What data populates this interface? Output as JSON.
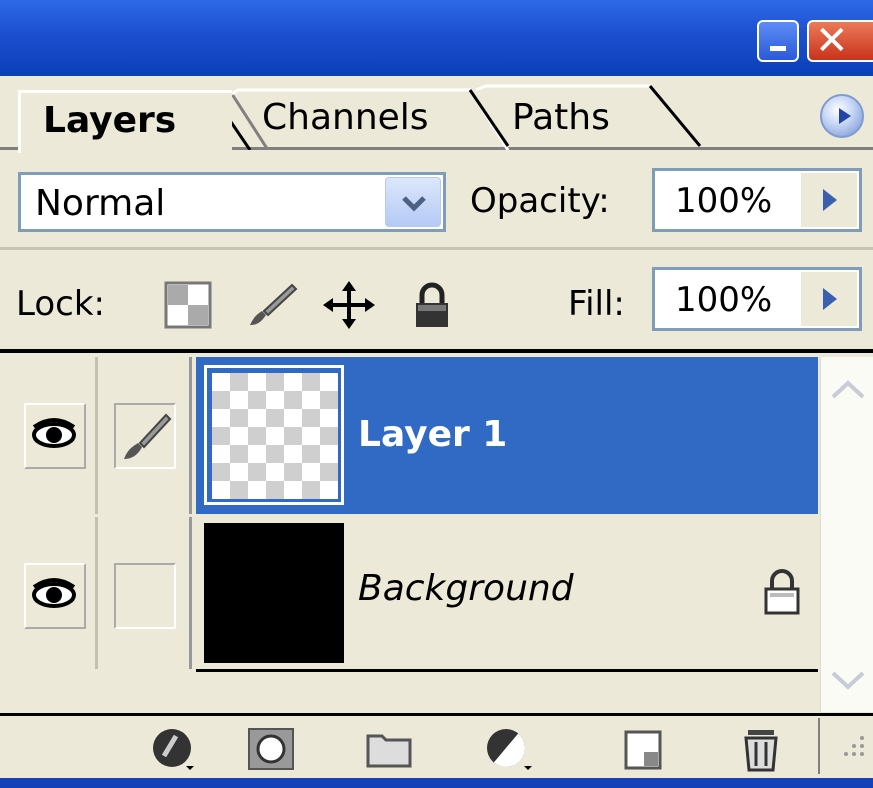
{
  "window": {
    "minimize_icon": "minimize-icon",
    "close_icon": "close-icon",
    "close_glyph": "✕"
  },
  "tabs": [
    {
      "label": "Layers",
      "active": true
    },
    {
      "label": "Channels",
      "active": false
    },
    {
      "label": "Paths",
      "active": false
    }
  ],
  "panel_menu_icon": "arrow-right-icon",
  "blend": {
    "mode": "Normal",
    "opacity_label": "Opacity:",
    "opacity_value": "100%"
  },
  "lock": {
    "label": "Lock:",
    "icons": [
      "transparency-lock-icon",
      "brush-lock-icon",
      "move-lock-icon",
      "padlock-icon"
    ],
    "fill_label": "Fill:",
    "fill_value": "100%"
  },
  "layers": [
    {
      "name": "Layer 1",
      "selected": true,
      "visible": true,
      "linked_icon": "brush-icon",
      "locked": false
    },
    {
      "name": "Background",
      "selected": false,
      "visible": true,
      "linked_icon": "",
      "locked": true
    }
  ],
  "colors": {
    "selection": "#316ac5",
    "panel_bg": "#ece9d8",
    "titlebar": "#1c4fcf"
  },
  "bottom_buttons": [
    "layer-style-icon",
    "layer-mask-icon",
    "new-group-icon",
    "adjustment-layer-icon",
    "new-layer-icon",
    "trash-icon"
  ]
}
